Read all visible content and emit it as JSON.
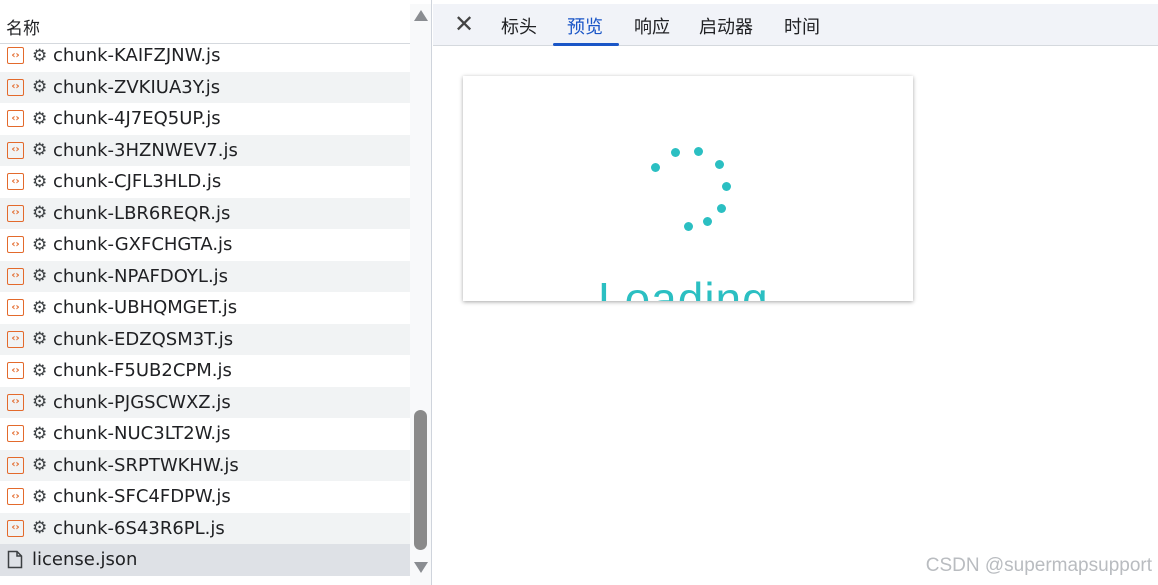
{
  "list": {
    "header": "名称",
    "rows": [
      {
        "name": "chunk-KAIFZJNW.js",
        "type": "script"
      },
      {
        "name": "chunk-ZVKIUA3Y.js",
        "type": "script"
      },
      {
        "name": "chunk-4J7EQ5UP.js",
        "type": "script"
      },
      {
        "name": "chunk-3HZNWEV7.js",
        "type": "script"
      },
      {
        "name": "chunk-CJFL3HLD.js",
        "type": "script"
      },
      {
        "name": "chunk-LBR6REQR.js",
        "type": "script"
      },
      {
        "name": "chunk-GXFCHGTA.js",
        "type": "script"
      },
      {
        "name": "chunk-NPAFDOYL.js",
        "type": "script"
      },
      {
        "name": "chunk-UBHQMGET.js",
        "type": "script"
      },
      {
        "name": "chunk-EDZQSM3T.js",
        "type": "script"
      },
      {
        "name": "chunk-F5UB2CPM.js",
        "type": "script"
      },
      {
        "name": "chunk-PJGSCWXZ.js",
        "type": "script"
      },
      {
        "name": "chunk-NUC3LT2W.js",
        "type": "script"
      },
      {
        "name": "chunk-SRPTWKHW.js",
        "type": "script"
      },
      {
        "name": "chunk-SFC4FDPW.js",
        "type": "script"
      },
      {
        "name": "chunk-6S43R6PL.js",
        "type": "script"
      },
      {
        "name": "license.json",
        "type": "document",
        "selected": true
      }
    ]
  },
  "details": {
    "close_icon": "close-icon",
    "tabs": [
      {
        "label": "标头",
        "active": false
      },
      {
        "label": "预览",
        "active": true
      },
      {
        "label": "响应",
        "active": false
      },
      {
        "label": "启动器",
        "active": false
      },
      {
        "label": "时间",
        "active": false
      }
    ],
    "preview": {
      "loading_text": "Loading"
    }
  },
  "watermark": "CSDN @supermapsupport",
  "colors": {
    "accent": "#1a56c7",
    "spinner": "#2bbfc2",
    "script_icon": "#e36a2c",
    "selected_row": "#dee1e6",
    "alt_row": "#f1f3f4"
  }
}
